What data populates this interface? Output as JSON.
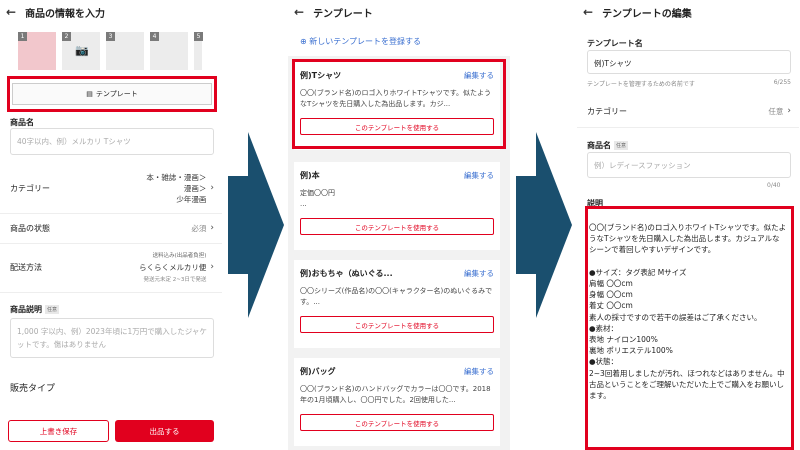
{
  "screen1": {
    "title": "商品の情報を入力",
    "thumb_numbers": [
      "1",
      "2",
      "3",
      "4",
      "5"
    ],
    "template_button": "テンプレート",
    "product_name_label": "商品名",
    "product_name_placeholder": "40字以内、例）メルカリ Tシャツ",
    "category_label": "カテゴリー",
    "category_value": [
      "本・雑誌・漫画＞",
      "漫画＞",
      "少年漫画"
    ],
    "condition_label": "商品の状態",
    "condition_value": "必須",
    "shipping_label": "配送方法",
    "shipping_badge": "送料込み(出品者負担)",
    "shipping_value": "らくらくメルカリ便",
    "shipping_note": "発送元未定 2~3日で発送",
    "desc_label": "商品説明",
    "desc_tag": "任意",
    "desc_placeholder": "1,000 字以内、例）2023年頃に1万円で購入したジャケットです。傷はありません",
    "sale_type_label": "販売タイプ",
    "save_draft": "上書き保存",
    "list_button": "出品する"
  },
  "screen2": {
    "title": "テンプレート",
    "new_template": "新しいテンプレートを登録する",
    "edit_label": "編集する",
    "use_label": "このテンプレートを使用する",
    "cards": [
      {
        "title": "例)Tシャツ",
        "body": "〇〇(ブランド名)のロゴ入りホワイトTシャツです。似たようなTシャツを先日購入した為出品します。カジ..."
      },
      {
        "title": "例)本",
        "body": "定価〇〇円\n..."
      },
      {
        "title": "例)おもちゃ（ぬいぐる...",
        "body": "〇〇シリーズ(作品名)の〇〇(キャラクター名)のぬいぐるみです。..."
      },
      {
        "title": "例)バッグ",
        "body": "〇〇(ブランド名)のハンドバッグでカラーは〇〇です。2018年の1月頃購入し、〇〇円でした。2回使用した..."
      }
    ]
  },
  "screen3": {
    "title": "テンプレートの編集",
    "name_label": "テンプレート名",
    "name_value": "例)Tシャツ",
    "name_hint": "テンプレートを管理するための名前です",
    "name_count": "6/255",
    "category_label": "カテゴリー",
    "category_value": "任意",
    "product_name_label": "商品名",
    "product_name_tag": "任意",
    "product_name_placeholder": "例）レディースファッション",
    "product_name_count": "0/40",
    "desc_label": "説明",
    "desc_text": "〇〇(ブランド名)のロゴ入りホワイトTシャツです。似たようなTシャツを先日購入した為出品します。カジュアルなシーンで着回しやすいデザインです。\n\n●サイズ：タグ表記 Mサイズ\n肩幅 〇〇cm\n身幅 〇〇cm\n着丈 〇〇cm\n素人の採寸ですので若干の誤差はご了承ください。\n●素材：\n表地 ナイロン100%\n裏地 ポリエステル100%\n●状態：\n2~3回着用しましたが汚れ、ほつれなどはありません。中古品ということをご理解いただいた上でご購入をお願いします。"
  },
  "colors": {
    "accent": "#e1001e",
    "link": "#3a6fd0",
    "arrow": "#1a4f6e"
  }
}
